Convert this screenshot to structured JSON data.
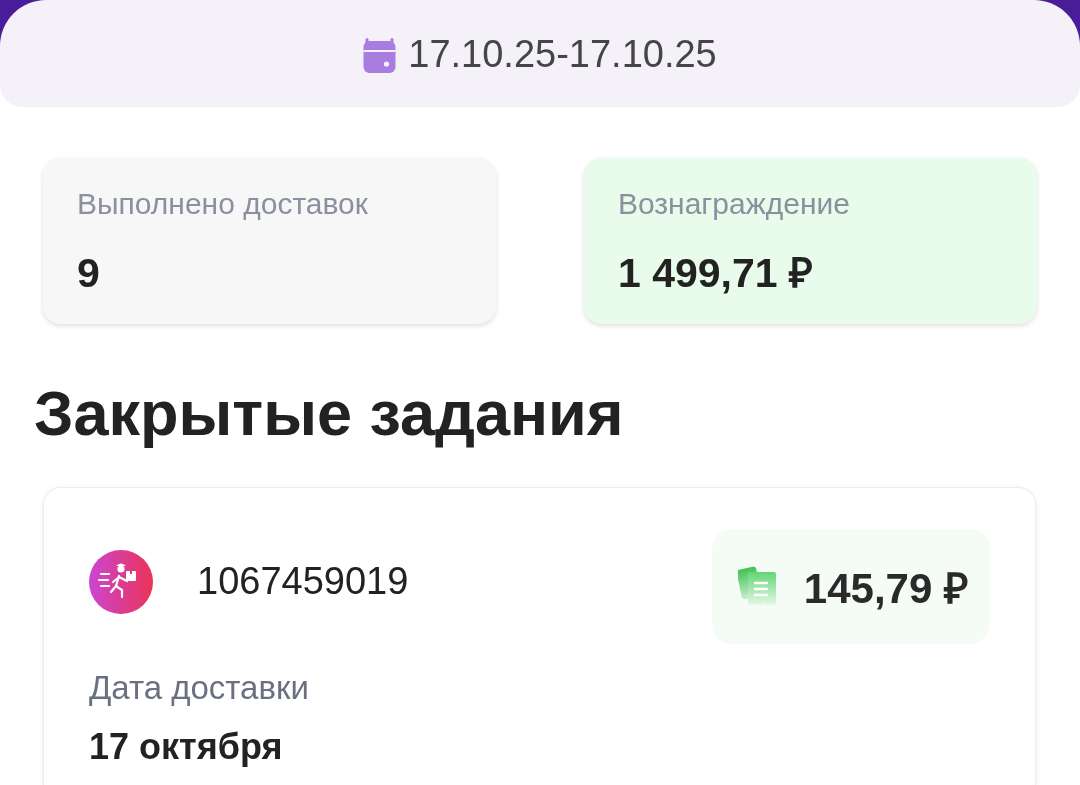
{
  "header": {
    "date_range": "17.10.25-17.10.25"
  },
  "stats": [
    {
      "kind": "plain",
      "label": "Выполнено доставок",
      "value": "9"
    },
    {
      "kind": "reward",
      "label": "Вознаграждение",
      "value": "1 499,71 ₽"
    }
  ],
  "section_title": "Закрытые задания",
  "tasks": [
    {
      "order_number": "1067459019",
      "amount": "145,79 ₽",
      "fields": [
        {
          "label": "Дата доставки",
          "value": "17 октября"
        }
      ]
    }
  ]
}
